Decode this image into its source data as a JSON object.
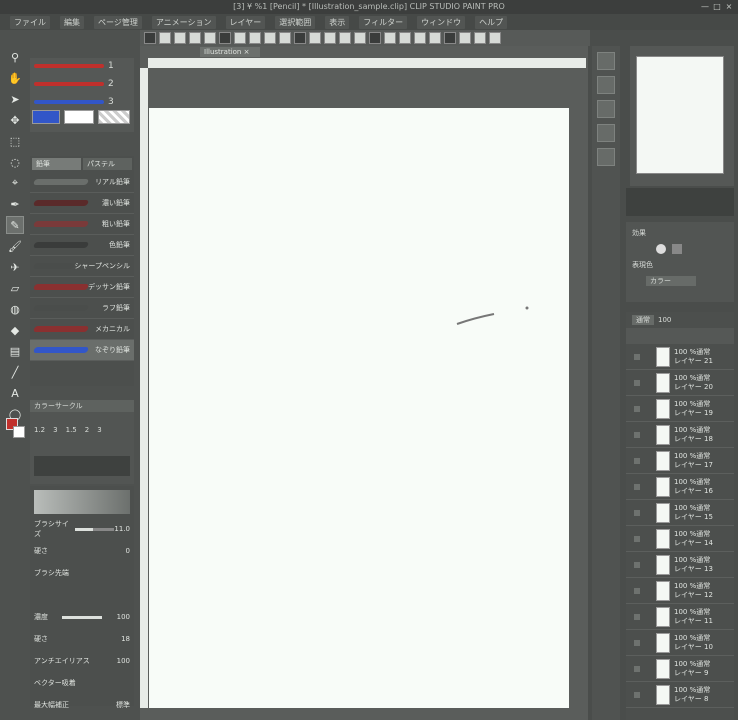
{
  "titlebar": {
    "title": "[3] ¥ %1 [Pencil] * [Illustration_sample.clip]   CLIP STUDIO PAINT PRO",
    "minimize": "—",
    "maximize": "□",
    "close": "×"
  },
  "menubar": {
    "items": [
      "ファイル",
      "編集",
      "ページ管理",
      "アニメーション",
      "レイヤー",
      "選択範囲",
      "表示",
      "フィルター",
      "ウィンドウ",
      "ヘルプ"
    ]
  },
  "document": {
    "tab_label": "Illustration ×"
  },
  "tools": [
    "zoom-icon",
    "hand-icon",
    "operation-icon",
    "move-icon",
    "selection-icon",
    "lasso-icon",
    "eyedropper-icon",
    "pen-icon",
    "pencil-icon",
    "brush-icon",
    "airbrush-icon",
    "eraser-icon",
    "blend-icon",
    "fill-icon",
    "gradient-icon",
    "figure-icon",
    "text-icon",
    "balloon-icon"
  ],
  "subtool_panel": {
    "brushes": [
      {
        "color": "#c0302c",
        "value": "1"
      },
      {
        "color": "#c0302c",
        "value": "2"
      },
      {
        "color": "#3256c8",
        "value": "3"
      }
    ]
  },
  "brush_list": {
    "tabs": [
      "鉛筆",
      "パステル"
    ],
    "items": [
      "リアル鉛筆",
      "濃い鉛筆",
      "粗い鉛筆",
      "色鉛筆",
      "シャープペンシル",
      "デッサン鉛筆",
      "ラフ鉛筆",
      "メカニカル",
      "なぞり鉛筆"
    ],
    "selected_index": 8
  },
  "color_panel": {
    "tabs": [
      "カラーサークル"
    ],
    "labels": [
      "1.2",
      "3",
      "1.5",
      "2",
      "3"
    ]
  },
  "tool_props": {
    "rows": [
      {
        "label": "ブラシサイズ",
        "value": "11.0"
      },
      {
        "label": "硬さ",
        "value": "0"
      },
      {
        "label": "ブラシ先端",
        "value": ""
      },
      {
        "label": "",
        "value": ""
      },
      {
        "label": "濃度",
        "value": "100"
      },
      {
        "label": "硬さ",
        "value": "18"
      },
      {
        "label": "アンチエイリアス",
        "value": "100"
      },
      {
        "label": "ベクター吸着",
        "value": ""
      },
      {
        "label": "最大幅補正",
        "value": "標準"
      }
    ],
    "brush_size_percent": 45,
    "density_percent": 100
  },
  "layer_property": {
    "label": "効果",
    "sublabel": "表現色",
    "mode": "カラー"
  },
  "layers": {
    "blend_mode": "通常",
    "opacity": "100",
    "items": [
      {
        "percent": "100 %通常",
        "name": "レイヤー 21"
      },
      {
        "percent": "100 %通常",
        "name": "レイヤー 20"
      },
      {
        "percent": "100 %通常",
        "name": "レイヤー 19"
      },
      {
        "percent": "100 %通常",
        "name": "レイヤー 18"
      },
      {
        "percent": "100 %通常",
        "name": "レイヤー 17"
      },
      {
        "percent": "100 %通常",
        "name": "レイヤー 16"
      },
      {
        "percent": "100 %通常",
        "name": "レイヤー 15"
      },
      {
        "percent": "100 %通常",
        "name": "レイヤー 14"
      },
      {
        "percent": "100 %通常",
        "name": "レイヤー 13"
      },
      {
        "percent": "100 %通常",
        "name": "レイヤー 12"
      },
      {
        "percent": "100 %通常",
        "name": "レイヤー 11"
      },
      {
        "percent": "100 %通常",
        "name": "レイヤー 10"
      },
      {
        "percent": "100 %通常",
        "name": "レイヤー 9"
      },
      {
        "percent": "100 %通常",
        "name": "レイヤー 8"
      }
    ]
  },
  "colors": {
    "main": "#c0302c",
    "sub": "#ffffff",
    "accent_blue": "#3256c8"
  }
}
